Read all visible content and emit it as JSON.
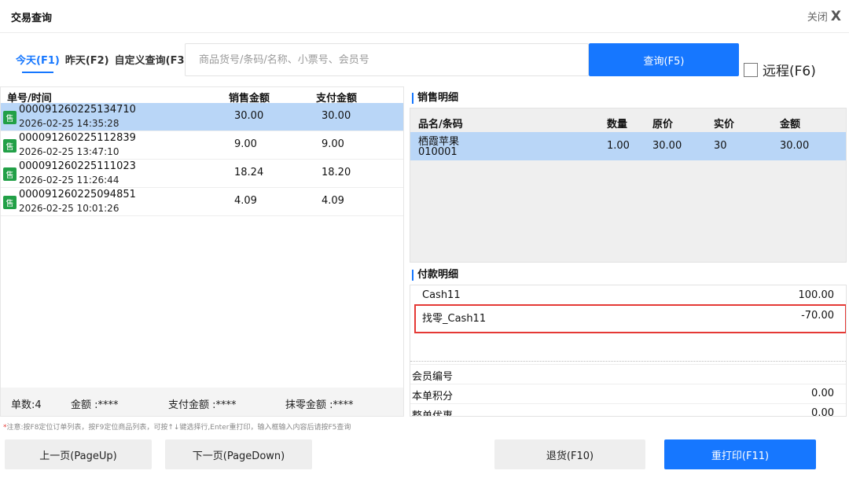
{
  "window": {
    "title": "交易查询",
    "close_label": "关闭",
    "close_icon": "X"
  },
  "tabs": [
    {
      "label": "今天(F1)",
      "active": true
    },
    {
      "label": "昨天(F2)",
      "active": false
    },
    {
      "label": "自定义查询(F3)",
      "active": false
    }
  ],
  "search": {
    "placeholder": "商品货号/条码/名称、小票号、会员号",
    "value": "",
    "button_label": "查询(F5)",
    "remote_label": "远程(F6)",
    "remote_checked": false
  },
  "orders": {
    "headers": [
      "单号/时间",
      "销售金额",
      "支付金额"
    ],
    "badge": "售",
    "rows": [
      {
        "order_no": "000091260225134710",
        "time": "2026-02-25 14:35:28",
        "sale_amount": "30.00",
        "pay_amount": "30.00",
        "selected": true
      },
      {
        "order_no": "000091260225112839",
        "time": "2026-02-25 13:47:10",
        "sale_amount": "9.00",
        "pay_amount": "9.00",
        "selected": false
      },
      {
        "order_no": "000091260225111023",
        "time": "2026-02-25 11:26:44",
        "sale_amount": "18.24",
        "pay_amount": "18.20",
        "selected": false
      },
      {
        "order_no": "000091260225094851",
        "time": "2026-02-25 10:01:26",
        "sale_amount": "4.09",
        "pay_amount": "4.09",
        "selected": false
      }
    ],
    "footer": {
      "count": "单数:4",
      "amount": "金额 :****",
      "pay_amount": "支付金额 :****",
      "rounding": "抹零金额 :****"
    }
  },
  "notice": {
    "star": "*",
    "text": "注意:按F8定位订单列表，按F9定位商品列表，可按↑↓键选择行,Enter重打印，输入框输入内容后请按F5查询"
  },
  "sales_detail": {
    "title": "销售明细",
    "headers": [
      "品名/条码",
      "数量",
      "原价",
      "实价",
      "金额"
    ],
    "rows": [
      {
        "name": "栖霞苹果",
        "barcode": "010001",
        "qty": "1.00",
        "orig_price": "30.00",
        "price": "30",
        "amount": "30.00"
      }
    ]
  },
  "payment_detail": {
    "title": "付款明细",
    "rows": [
      {
        "name": "Cash11",
        "amount": "100.00"
      },
      {
        "name": "找零_Cash11",
        "amount": "-70.00"
      }
    ],
    "info": [
      {
        "label": "会员编号",
        "value": ""
      },
      {
        "label": "本单积分",
        "value": "0.00"
      },
      {
        "label": "整单优惠",
        "value": "0.00"
      }
    ]
  },
  "buttons": {
    "prev_page": "上一页(PageUp)",
    "next_page": "下一页(PageDown)",
    "return": "退货(F10)",
    "reprint": "重打印(F11)"
  },
  "colors": {
    "accent": "#1677ff",
    "selected_row": "#b9d6f7",
    "sale_badge": "#22a047",
    "highlight": "#e53935"
  }
}
